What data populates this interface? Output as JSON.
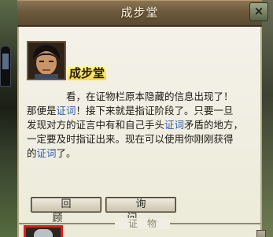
{
  "window": {
    "title": "成步堂",
    "close_label": "×"
  },
  "speaker": {
    "name": "成步堂",
    "portrait_icon": "character-portrait-naruhodo"
  },
  "dialog": {
    "line1_prefix": "看，在证物栏原本隐藏的信息出现了！",
    "line2_a": "那便是",
    "line2_keyword": "证词",
    "line2_b": "！接下来就是指证阶段了。只要一旦",
    "line3_a": "发现对方的证言中有和自己手头",
    "line3_keyword": "证词",
    "line3_b": "矛盾的地方，",
    "line4": "一定要及时指证出来。现在可以使用你刚刚获得",
    "line5_a": "的",
    "line5_keyword": "证词",
    "line5_b": "了。"
  },
  "buttons": {
    "review_label": "回顾",
    "inquire_label": "询问"
  },
  "evidence": {
    "label": "证物",
    "slot_icon": "evidence-portrait-icon",
    "highlight_color": "#e11c1c"
  },
  "colors": {
    "keyword": "#2d5ea8",
    "speaker_highlight": "#f3d64a",
    "titlebar": "#6d5a3e"
  }
}
